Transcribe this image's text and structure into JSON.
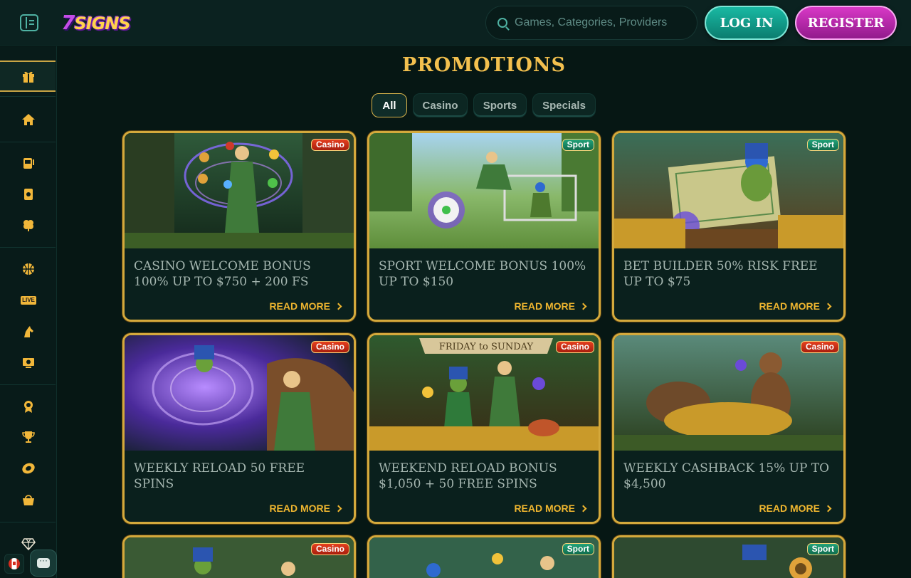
{
  "header": {
    "logo_text": "7SIGNS",
    "search_placeholder": "Games, Categories, Providers",
    "login_label": "LOG IN",
    "register_label": "REGISTER"
  },
  "sidebar": {
    "items": [
      {
        "icon": "gift-icon",
        "active": true
      },
      {
        "icon": "home-icon"
      },
      {
        "icon": "slot-machine-icon"
      },
      {
        "icon": "card-icon"
      },
      {
        "icon": "clover-icon"
      },
      {
        "icon": "basketball-icon"
      },
      {
        "icon": "live-icon",
        "label": "LIVE"
      },
      {
        "icon": "horse-icon"
      },
      {
        "icon": "virtual-sports-icon"
      },
      {
        "icon": "badge-icon"
      },
      {
        "icon": "trophy-icon"
      },
      {
        "icon": "coin-icon"
      },
      {
        "icon": "basket-icon"
      },
      {
        "icon": "diamond-icon"
      }
    ]
  },
  "page": {
    "title": "PROMOTIONS"
  },
  "filters": [
    {
      "label": "All",
      "active": true
    },
    {
      "label": "Casino"
    },
    {
      "label": "Sports"
    },
    {
      "label": "Specials"
    }
  ],
  "promotions": [
    {
      "tag": "Casino",
      "title": "CASINO WELCOME BONUS 100% UP TO $750 + 200 FS",
      "cta": "READ MORE"
    },
    {
      "tag": "Sport",
      "title": "SPORT WELCOME BONUS 100% UP TO $150",
      "cta": "READ MORE"
    },
    {
      "tag": "Sport",
      "title": "BET BUILDER 50% RISK FREE UP TO $75",
      "cta": "READ MORE"
    },
    {
      "tag": "Casino",
      "title": "WEEKLY RELOAD 50 FREE SPINS",
      "cta": "READ MORE"
    },
    {
      "tag": "Casino",
      "title": "WEEKEND RELOAD BONUS $1,050 + 50 FREE SPINS",
      "cta": "READ MORE",
      "banner_text": "FRIDAY to SUNDAY"
    },
    {
      "tag": "Casino",
      "title": "WEEKLY CASHBACK 15% UP TO $4,500",
      "cta": "READ MORE"
    },
    {
      "tag": "Casino",
      "title": "",
      "cta": ""
    },
    {
      "tag": "Sport",
      "title": "",
      "cta": ""
    },
    {
      "tag": "Sport",
      "title": "",
      "cta": ""
    }
  ],
  "colors": {
    "accent_gold": "#f3c04e",
    "login_teal": "#19b9a3",
    "register_magenta": "#d838c6",
    "casino_tag": "#e5401f",
    "sport_tag": "#22a37a"
  }
}
